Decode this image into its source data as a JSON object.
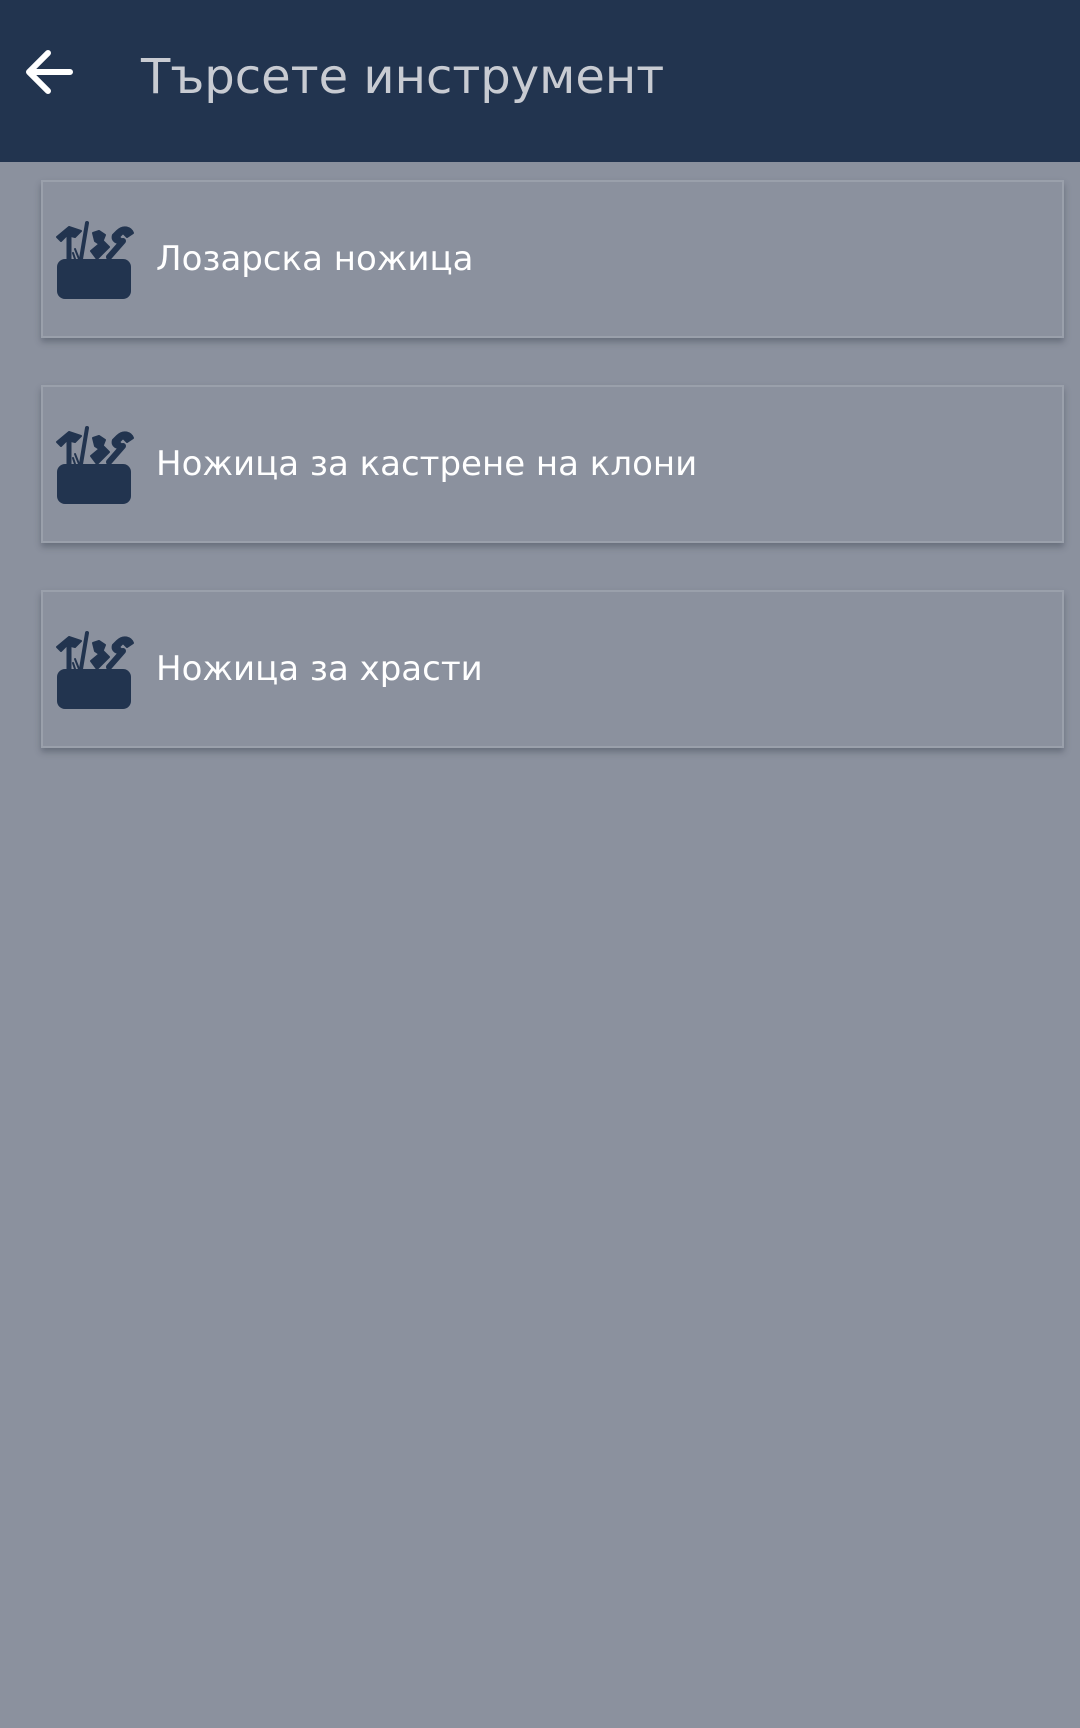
{
  "header": {
    "title": "Търсете инструмент",
    "back_icon": "arrow-left-icon",
    "background_color": "#22344f",
    "title_color": "#c8cbd2"
  },
  "results": [
    {
      "label": "Лозарска ножица",
      "icon": "toolbox-icon"
    },
    {
      "label": "Ножица за кастрене на клони",
      "icon": "toolbox-icon"
    },
    {
      "label": "Ножица за храсти",
      "icon": "toolbox-icon"
    }
  ],
  "colors": {
    "page_background": "#8b919e",
    "icon_color": "#22344f",
    "item_text": "#ffffff"
  }
}
